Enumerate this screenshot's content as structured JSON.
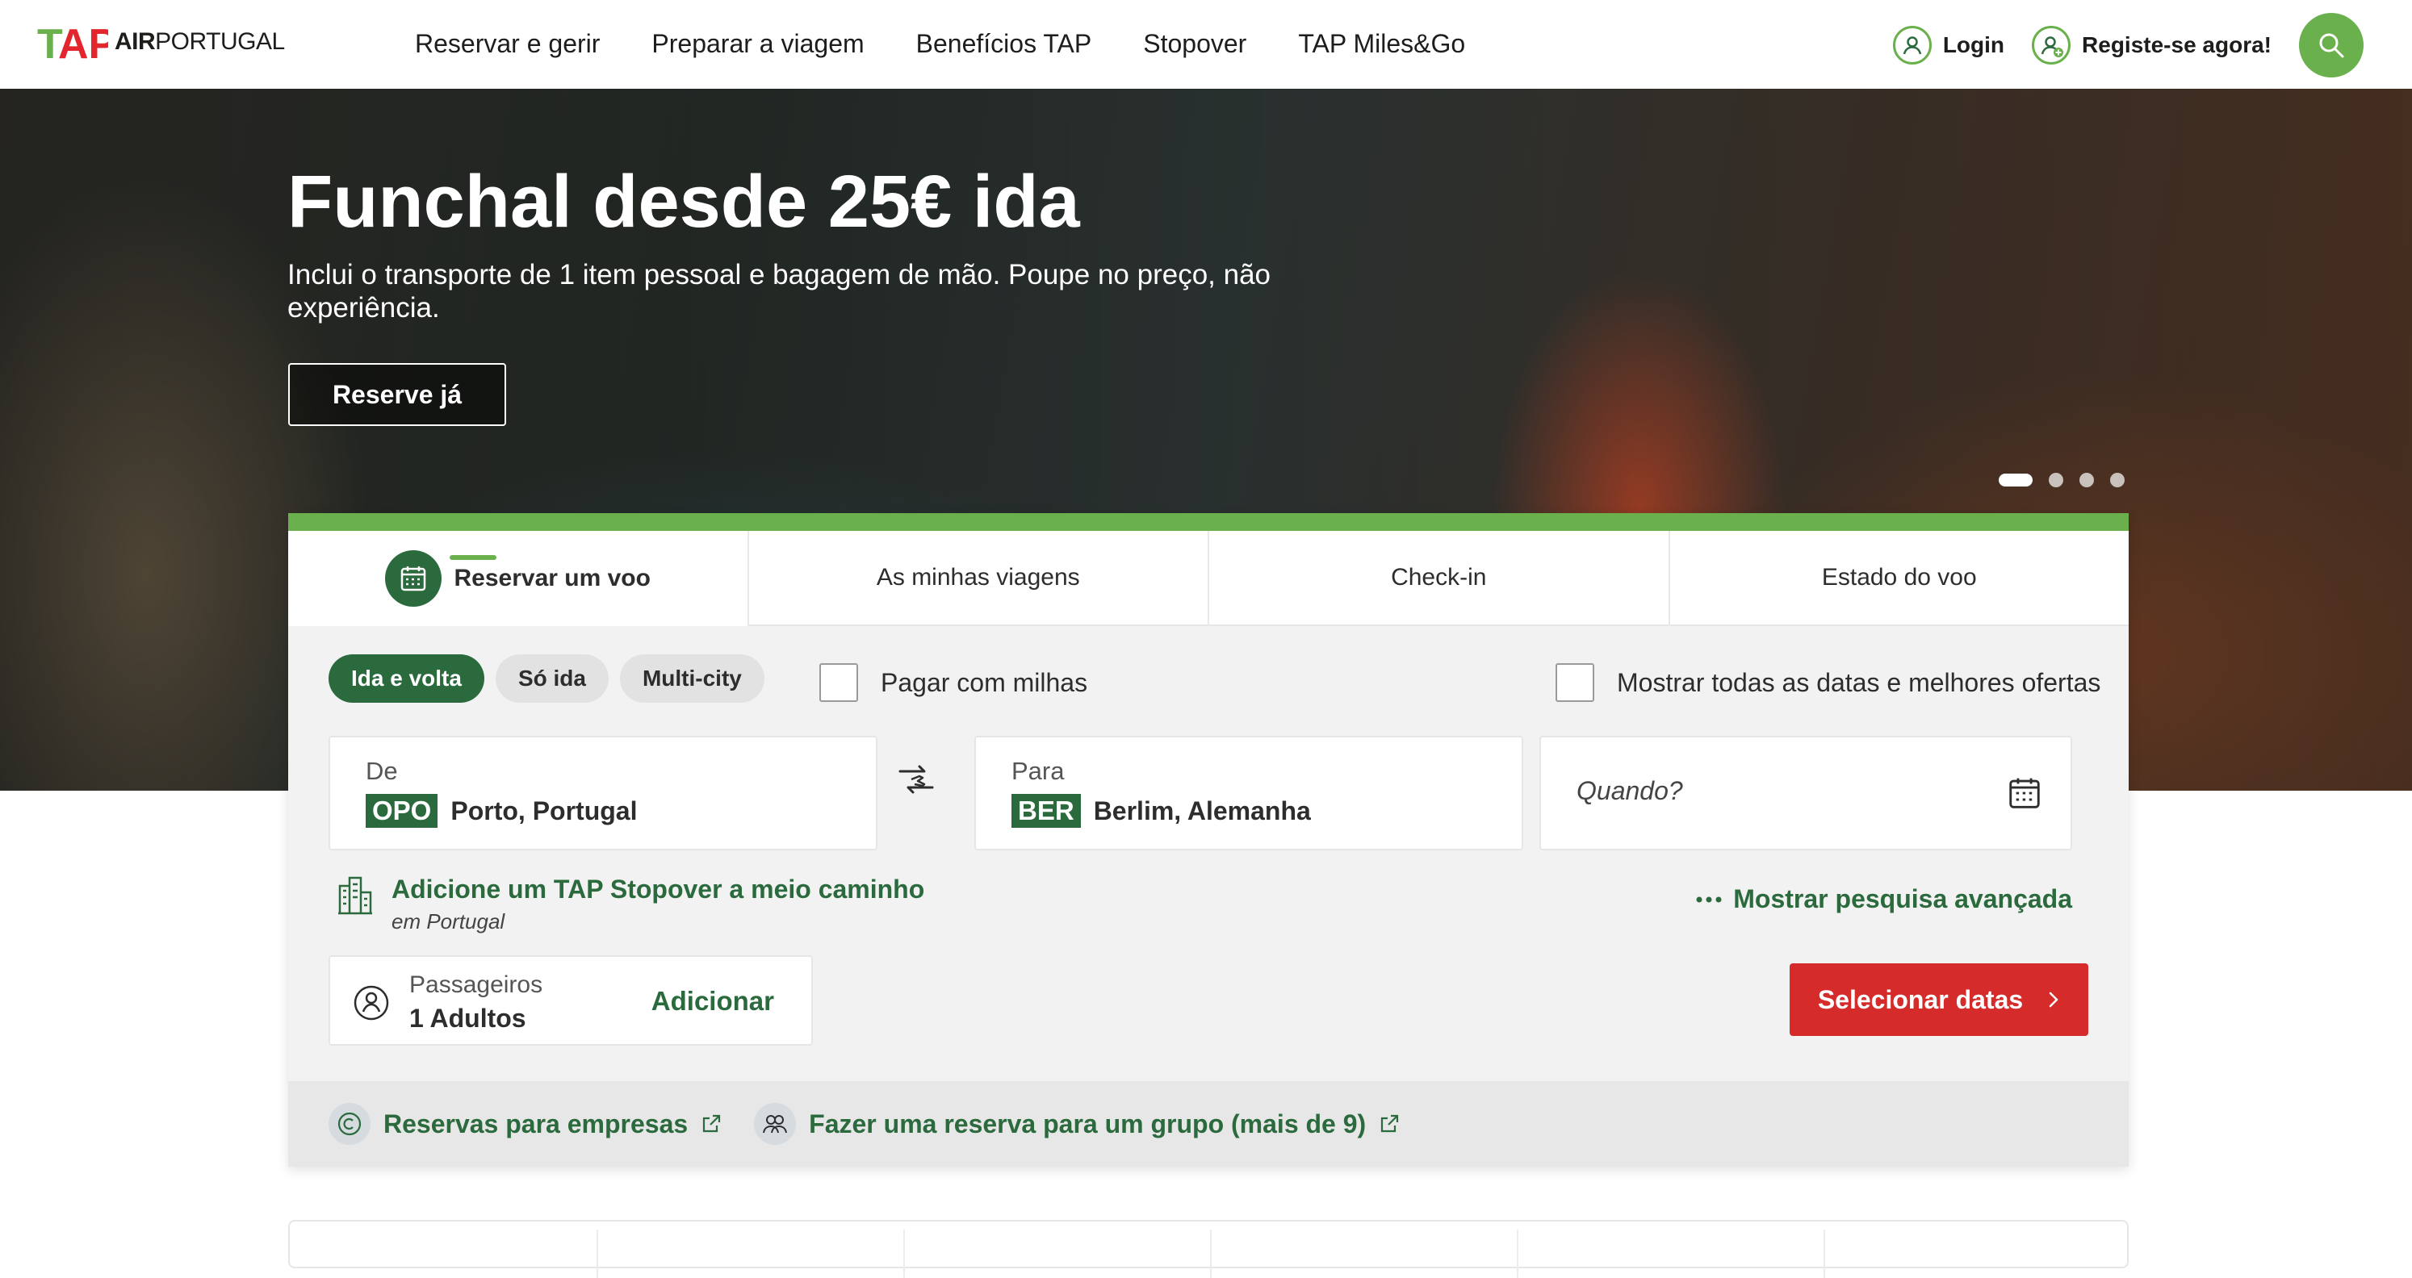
{
  "brand": {
    "logo_mark": "TAP",
    "logo_bold": "AIR",
    "logo_light": "PORTUGAL",
    "colors": {
      "green": "#6ab04c",
      "dark_green": "#2a6a3d",
      "red": "#d52b2b",
      "logo_red": "#e3262d"
    }
  },
  "nav": {
    "items": [
      "Reservar e gerir",
      "Preparar a viagem",
      "Benefícios TAP",
      "Stopover",
      "TAP Miles&Go"
    ]
  },
  "header": {
    "login_label": "Login",
    "register_label": "Registe-se agora!",
    "search_icon": "search-icon"
  },
  "hero": {
    "title": "Funchal desde 25€ ida",
    "subtitle": "Inclui o transporte de 1 item pessoal e bagagem de mão. Poupe no preço, não experiência.",
    "cta_label": "Reserve já",
    "slides_total": 4,
    "active_slide": 1
  },
  "booking": {
    "tabs": [
      {
        "label": "Reservar um voo",
        "icon": "calendar-icon"
      },
      {
        "label": "As minhas viagens"
      },
      {
        "label": "Check-in"
      },
      {
        "label": "Estado do voo"
      }
    ],
    "trip_types": [
      "Ida e volta",
      "Só ida",
      "Multi-city"
    ],
    "selected_trip_type": "Ida e volta",
    "pay_with_miles_label": "Pagar com milhas",
    "show_all_dates_label": "Mostrar todas as datas e melhores ofertas",
    "from": {
      "label": "De",
      "code": "OPO",
      "city": "Porto, Portugal"
    },
    "to": {
      "label": "Para",
      "code": "BER",
      "city": "Berlim, Alemanha"
    },
    "when": {
      "placeholder": "Quando?"
    },
    "stopover": {
      "title": "Adicione um TAP Stopover a meio caminho",
      "subtitle": "em Portugal"
    },
    "advanced_search_label": "Mostrar pesquisa avançada",
    "passengers": {
      "label": "Passageiros",
      "value": "1 Adultos",
      "add_label": "Adicionar"
    },
    "select_dates_label": "Selecionar datas",
    "footer_links": [
      "Reservas para empresas",
      "Fazer uma reserva para um grupo (mais de 9)"
    ]
  }
}
